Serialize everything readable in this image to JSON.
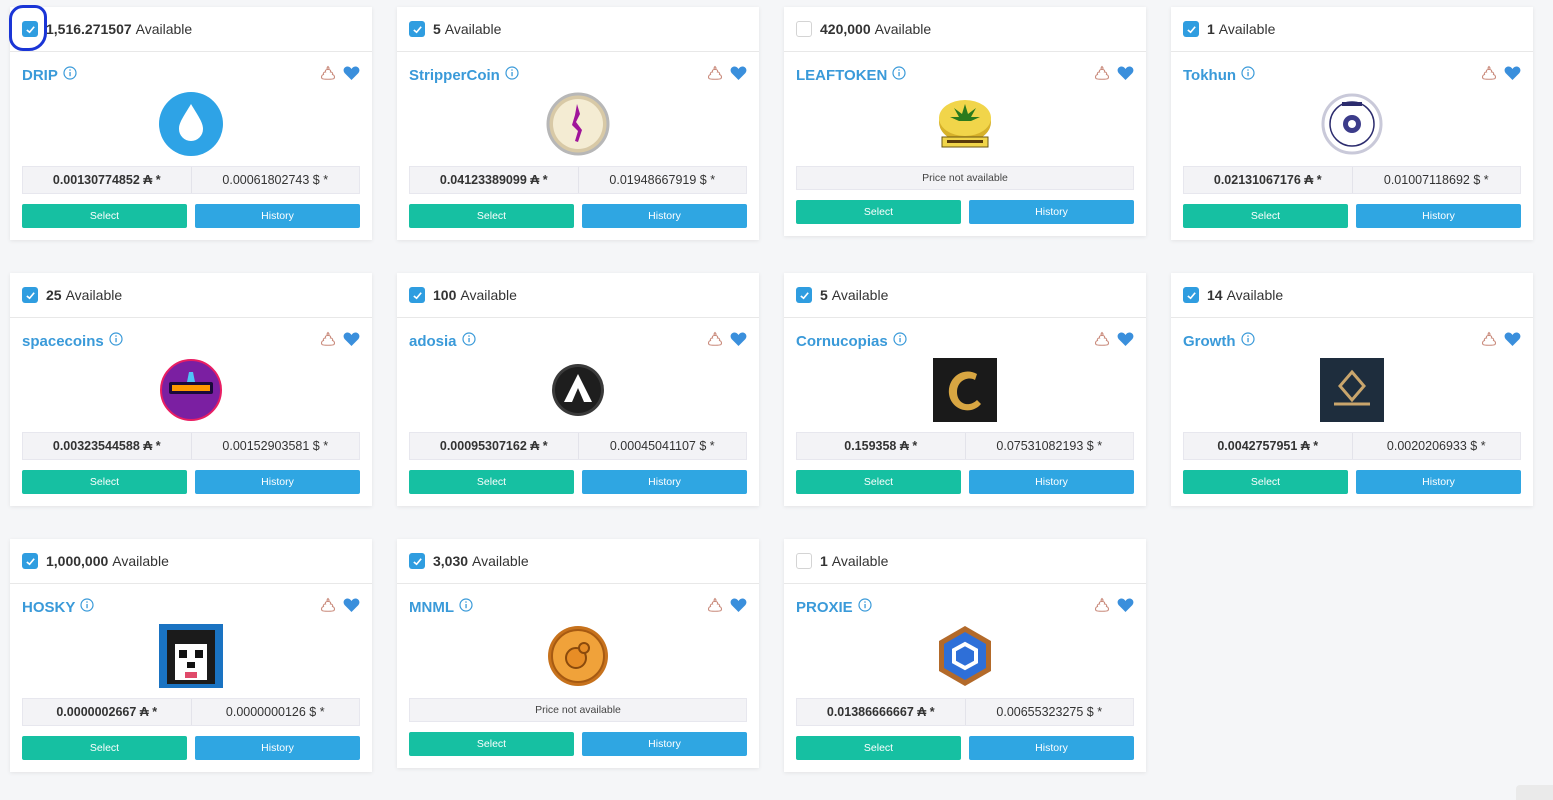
{
  "labels": {
    "available_suffix": "Available",
    "price_unavailable": "Price not available",
    "select_button": "Select",
    "history_button": "History"
  },
  "colors": {
    "accent_blue": "#3a9ad9",
    "select_green": "#16c0a2",
    "history_blue": "#2fa6e2",
    "checkbox_blue": "#2f9de0"
  },
  "tokens": [
    {
      "name": "DRIP",
      "available": "1,516.271507",
      "checked": true,
      "price_ada": "0.00130774852 ₳ *",
      "price_usd": "0.00061802743 $ *",
      "logo": "drip-logo"
    },
    {
      "name": "StripperCoin",
      "available": "5",
      "checked": true,
      "price_ada": "0.04123389099 ₳ *",
      "price_usd": "0.01948667919 $ *",
      "logo": "strippercoin-logo"
    },
    {
      "name": "LEAFTOKEN",
      "available": "420,000",
      "checked": false,
      "price_ada": null,
      "price_usd": null,
      "logo": "leaftoken-logo"
    },
    {
      "name": "Tokhun",
      "available": "1",
      "checked": true,
      "price_ada": "0.02131067176 ₳ *",
      "price_usd": "0.01007118692 $ *",
      "logo": "tokhun-logo"
    },
    {
      "name": "spacecoins",
      "available": "25",
      "checked": true,
      "price_ada": "0.00323544588 ₳ *",
      "price_usd": "0.00152903581 $ *",
      "logo": "spacecoins-logo"
    },
    {
      "name": "adosia",
      "available": "100",
      "checked": true,
      "price_ada": "0.00095307162 ₳ *",
      "price_usd": "0.00045041107 $ *",
      "logo": "adosia-logo"
    },
    {
      "name": "Cornucopias",
      "available": "5",
      "checked": true,
      "price_ada": "0.159358 ₳ *",
      "price_usd": "0.07531082193 $ *",
      "logo": "cornucopias-logo"
    },
    {
      "name": "Growth",
      "available": "14",
      "checked": true,
      "price_ada": "0.0042757951 ₳ *",
      "price_usd": "0.0020206933 $ *",
      "logo": "growth-logo"
    },
    {
      "name": "HOSKY",
      "available": "1,000,000",
      "checked": true,
      "price_ada": "0.0000002667 ₳ *",
      "price_usd": "0.0000000126 $ *",
      "logo": "hosky-logo"
    },
    {
      "name": "MNML",
      "available": "3,030",
      "checked": true,
      "price_ada": null,
      "price_usd": null,
      "logo": "mnml-logo"
    },
    {
      "name": "PROXIE",
      "available": "1",
      "checked": false,
      "price_ada": "0.01386666667 ₳ *",
      "price_usd": "0.00655323275 $ *",
      "logo": "proxie-logo"
    }
  ]
}
